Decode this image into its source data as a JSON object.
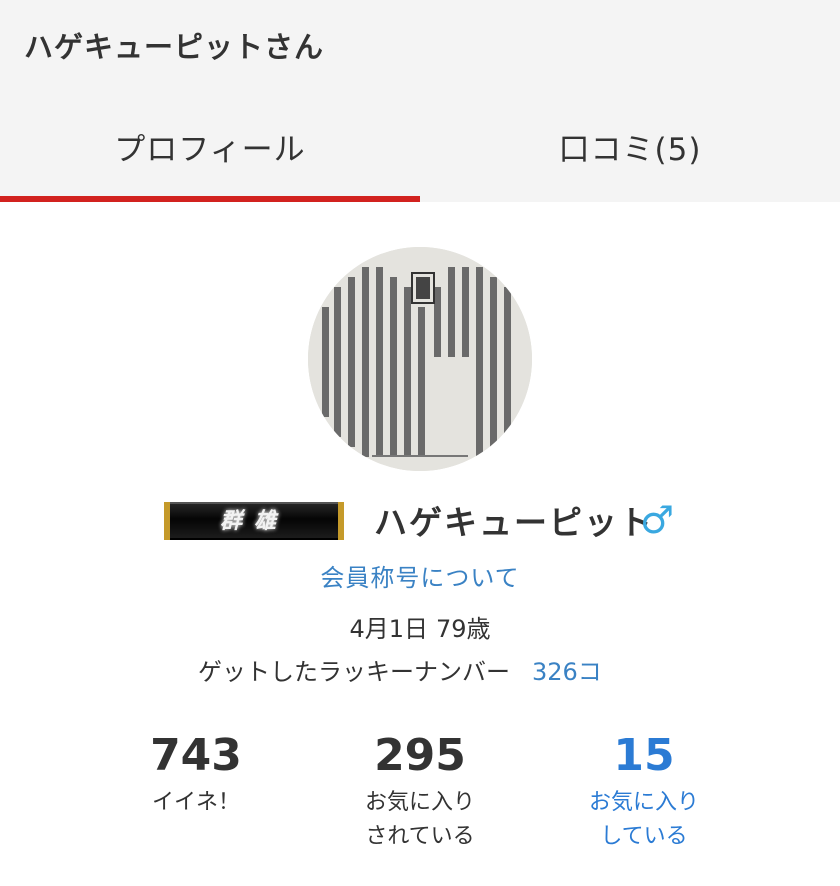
{
  "header": {
    "title": "ハゲキューピットさん",
    "tabs": [
      {
        "label": "プロフィール",
        "active": true
      },
      {
        "label": "口コミ(5)",
        "active": false
      }
    ],
    "accent_color": "#d2221f"
  },
  "profile": {
    "avatar_icon": "dictionary-page-photo",
    "badge_text": "群雄",
    "username": "ハゲキューピット",
    "gender_icon": "♂",
    "gender_color": "#3aa8e0",
    "title_link": "会員称号について",
    "birthday": "4月1日",
    "age": "79歳",
    "lucky_label": "ゲットしたラッキーナンバー",
    "lucky_count": "326コ",
    "link_color": "#3a82c4"
  },
  "stats": [
    {
      "value": "743",
      "label": "イイネ！"
    },
    {
      "value": "295",
      "label": "お気に入り\nされている"
    },
    {
      "value": "15",
      "label": "お気に入り\nしている"
    }
  ]
}
